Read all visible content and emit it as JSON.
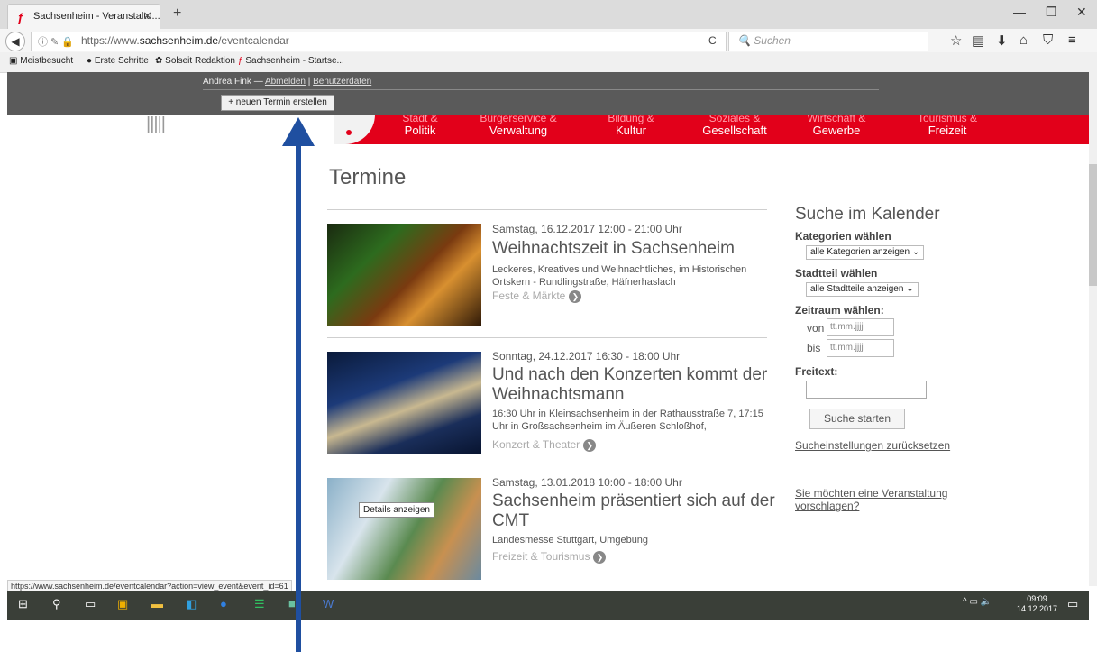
{
  "browser": {
    "tab_title": "Sachsenheim - Veranstaltu...",
    "tab_close": "✕",
    "new_tab": "+",
    "url_host": "https://www.sachsenheim.de/",
    "url_host_bold": "sachsenheim.de",
    "url_prefix": "https://www.",
    "url_path": "/eventcalendar",
    "search_placeholder": "Suchen",
    "bookmarks": [
      "Meistbesucht",
      "Erste Schritte",
      "Solseit Redaktion",
      "Sachsenheim - Startse..."
    ]
  },
  "admin": {
    "user": "Andrea Fink",
    "dash": "—",
    "logout": "Abmelden",
    "separator": "|",
    "userdata": "Benutzerdaten",
    "new_event": "+ neuen Termin erstellen"
  },
  "nav": {
    "items": [
      {
        "line1": "Stadt &",
        "line2": "Politik"
      },
      {
        "line1": "Bürgerservice &",
        "line2": "Verwaltung"
      },
      {
        "line1": "Bildung &",
        "line2": "Kultur"
      },
      {
        "line1": "Soziales &",
        "line2": "Gesellschaft"
      },
      {
        "line1": "Wirtschaft &",
        "line2": "Gewerbe"
      },
      {
        "line1": "Tourismus &",
        "line2": "Freizeit"
      }
    ]
  },
  "main": {
    "title": "Termine",
    "events": [
      {
        "date": "Samstag, 16.12.2017  12:00 - 21:00 Uhr",
        "title": "Weihnachtszeit in Sachsenheim",
        "desc": "Leckeres, Kreatives und Weihnachtliches, im Historischen Ortskern - Rundlingstraße, Häfnerhaslach",
        "category": "Feste & Märkte"
      },
      {
        "date": "Sonntag, 24.12.2017  16:30 - 18:00 Uhr",
        "title": "Und nach den Konzerten kommt der Weihnachtsmann",
        "desc": "16:30 Uhr in Kleinsachsenheim in der Rathausstraße 7, 17:15 Uhr in Großsachsenheim im Äußeren Schloßhof,",
        "category": "Konzert & Theater"
      },
      {
        "date": "Samstag, 13.01.2018  10:00 - 18:00 Uhr",
        "title": "Sachsenheim präsentiert sich auf der CMT",
        "desc": "Landesmesse Stuttgart, Umgebung",
        "category": "Freizeit & Tourismus"
      }
    ],
    "tooltip": "Details anzeigen"
  },
  "sidebar": {
    "title": "Suche im Kalender",
    "cat_label": "Kategorien wählen",
    "cat_value": "alle Kategorien anzeigen",
    "district_label": "Stadtteil wählen",
    "district_value": "alle Stadtteile anzeigen",
    "period_label": "Zeitraum wählen:",
    "from_label": "von",
    "to_label": "bis",
    "date_placeholder": "tt.mm.jjjj",
    "freetext_label": "Freitext:",
    "search_button": "Suche starten",
    "reset_link": "Sucheinstellungen zurücksetzen",
    "suggest_link": "Sie möchten eine Veranstaltung vorschlagen?"
  },
  "status": {
    "url": "https://www.sachsenheim.de/eventcalendar?action=view_event&event_id=61"
  },
  "taskbar": {
    "time": "09:09",
    "date": "14.12.2017"
  },
  "colors": {
    "brand_red": "#e2001a",
    "annotation_arrow": "#1f4fa0"
  }
}
